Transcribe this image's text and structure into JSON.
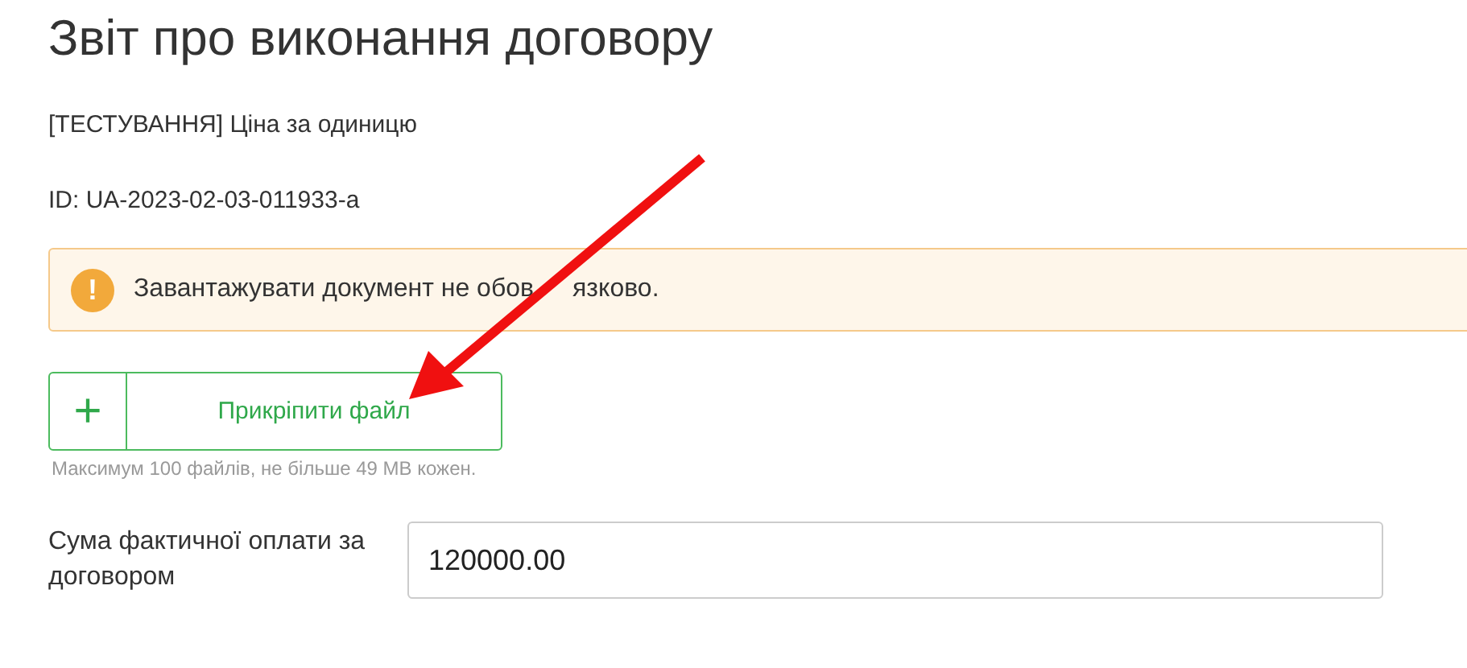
{
  "title": "Звіт про виконання договору",
  "tender_name": "[ТЕСТУВАННЯ] Ціна за одиницю",
  "tender_id": "ID: UA-2023-02-03-011933-a",
  "alert": {
    "icon": "!",
    "text": [
      "Завантажувати документ не обов",
      "язково."
    ]
  },
  "attach": {
    "icon": "+",
    "label": "Прикріпити файл",
    "hint": "Максимум 100 файлів, не більше 49 MB кожен."
  },
  "amount": {
    "label": "Сума фактичної оплати за договором",
    "value": "120000.00"
  }
}
